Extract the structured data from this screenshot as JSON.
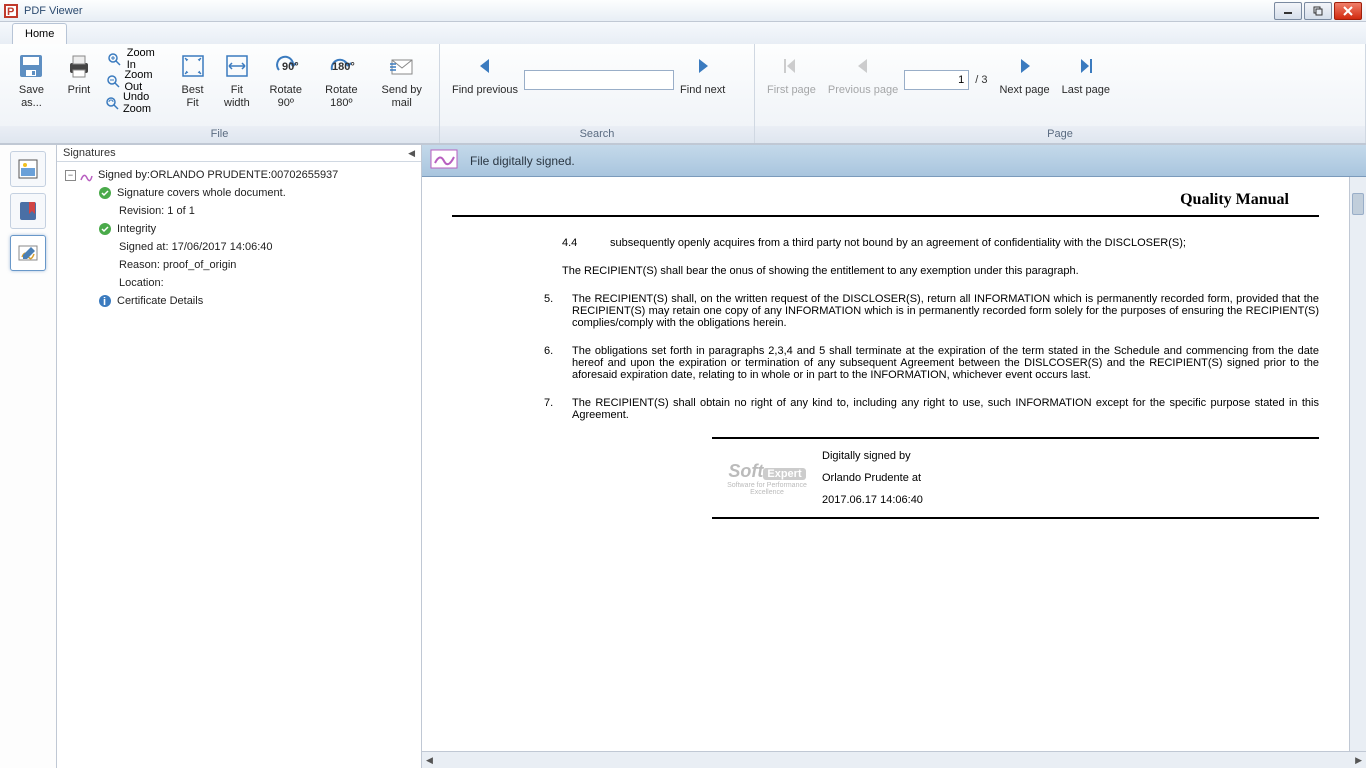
{
  "window": {
    "title": "PDF Viewer"
  },
  "ribbon": {
    "tab": "Home",
    "file": {
      "label": "File",
      "save": "Save as...",
      "print": "Print",
      "zoom_in": "Zoom In",
      "zoom_out": "Zoom Out",
      "undo_zoom": "Undo Zoom",
      "best_fit": "Best Fit",
      "fit_width": "Fit width",
      "rotate90": "Rotate 90º",
      "rotate180": "Rotate 180º",
      "send_mail": "Send by mail"
    },
    "search": {
      "label": "Search",
      "find_prev": "Find previous",
      "find_next": "Find next",
      "query": ""
    },
    "page": {
      "label": "Page",
      "first": "First page",
      "prev": "Previous page",
      "current": "1",
      "total": "/ 3",
      "next": "Next page",
      "last": "Last page"
    }
  },
  "sig_panel": {
    "header": "Signatures",
    "signed_by": "Signed by:ORLANDO PRUDENTE:00702655937",
    "covers": "Signature covers whole document.",
    "revision": "Revision: 1 of 1",
    "integrity": "Integrity",
    "signed_at": "Signed at: 17/06/2017 14:06:40",
    "reason": "Reason: proof_of_origin",
    "location": "Location:",
    "cert": "Certificate Details"
  },
  "banner": {
    "msg": "File digitally signed."
  },
  "doc": {
    "title": "Quality Manual",
    "c44_num": "4.4",
    "c44": "subsequently openly acquires from a third party not bound by an agreement of confidentiality with the DISCLOSER(S);",
    "p_onus": "The RECIPIENT(S) shall bear the onus of showing the entitlement to any exemption under this paragraph.",
    "c5_num": "5.",
    "c5": "The RECIPIENT(S) shall, on the written request of the DISCLOSER(S), return all INFORMATION which is permanently recorded form, provided that the RECIPIENT(S) may retain one copy of any INFORMATION which is in permanently recorded form solely for the purposes of ensuring the RECIPIENT(S) complies/comply with the obligations herein.",
    "c6_num": "6.",
    "c6": "The obligations set forth in paragraphs 2,3,4 and 5 shall terminate at the expiration of the term stated in the Schedule and commencing from the date hereof and upon the expiration or termination of any subsequent Agreement between the DISLCOSER(S) and the RECIPIENT(S) signed prior to the aforesaid expiration date, relating to in whole or in part to the INFORMATION, whichever event occurs last.",
    "c7_num": "7.",
    "c7": "The RECIPIENT(S) shall obtain no right of any kind to, including any right to use, such INFORMATION except for the specific purpose stated in this Agreement.",
    "sig_l1": "Digitally signed by",
    "sig_l2": "Orlando Prudente at",
    "sig_l3": "2017.06.17 14:06:40"
  }
}
